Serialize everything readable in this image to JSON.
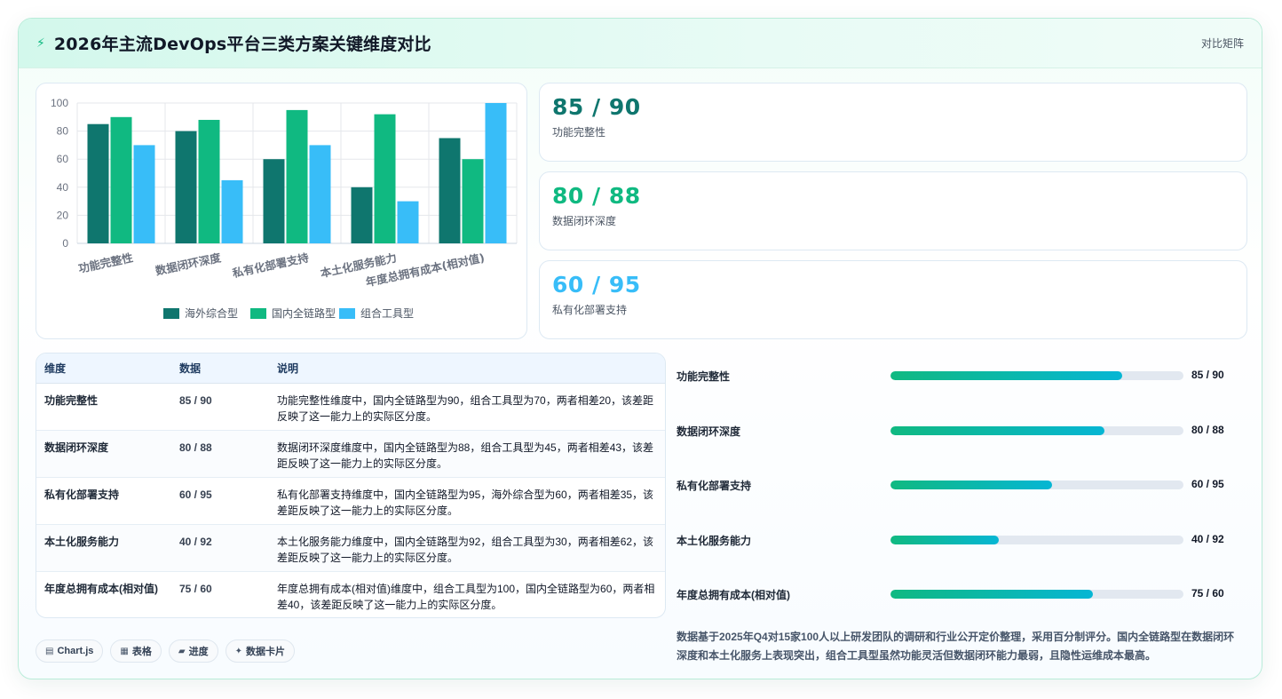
{
  "header": {
    "icon": "bolt-icon",
    "title": "2026年主流DevOps平台三类方案关键维度对比",
    "badge": "对比矩阵"
  },
  "colors": {
    "series_1": "#0f766e",
    "series_2": "#10b981",
    "series_3": "#38bdf8"
  },
  "chart_data": {
    "type": "bar",
    "categories": [
      "功能完整性",
      "数据闭环深度",
      "私有化部署支持",
      "本土化服务能力",
      "年度总拥有成本(相对值)"
    ],
    "series": [
      {
        "name": "海外综合型",
        "values": [
          85,
          80,
          60,
          40,
          75
        ]
      },
      {
        "name": "国内全链路型",
        "values": [
          90,
          88,
          95,
          92,
          60
        ]
      },
      {
        "name": "组合工具型",
        "values": [
          70,
          45,
          70,
          30,
          100
        ]
      }
    ],
    "ylim": [
      0,
      100
    ],
    "yticks": [
      0,
      20,
      40,
      60,
      80,
      100
    ],
    "grid": true,
    "legend_position": "bottom"
  },
  "stats": [
    {
      "value": "85 / 90",
      "label": "功能完整性",
      "color": "#0f766e"
    },
    {
      "value": "80 / 88",
      "label": "数据闭环深度",
      "color": "#10b981"
    },
    {
      "value": "60 / 95",
      "label": "私有化部署支持",
      "color": "#38bdf8"
    }
  ],
  "table": {
    "headers": [
      "维度",
      "数据",
      "说明"
    ],
    "rows": [
      {
        "dim": "功能完整性",
        "data": "85 / 90",
        "desc": "功能完整性维度中，国内全链路型为90，组合工具型为70，两者相差20，该差距反映了这一能力上的实际区分度。"
      },
      {
        "dim": "数据闭环深度",
        "data": "80 / 88",
        "desc": "数据闭环深度维度中，国内全链路型为88，组合工具型为45，两者相差43，该差距反映了这一能力上的实际区分度。"
      },
      {
        "dim": "私有化部署支持",
        "data": "60 / 95",
        "desc": "私有化部署支持维度中，国内全链路型为95，海外综合型为60，两者相差35，该差距反映了这一能力上的实际区分度。"
      },
      {
        "dim": "本土化服务能力",
        "data": "40 / 92",
        "desc": "本土化服务能力维度中，国内全链路型为92，组合工具型为30，两者相差62，该差距反映了这一能力上的实际区分度。"
      },
      {
        "dim": "年度总拥有成本(相对值)",
        "data": "75 / 60",
        "desc": "年度总拥有成本(相对值)维度中，组合工具型为100，国内全链路型为60，两者相差40，该差距反映了这一能力上的实际区分度。"
      }
    ]
  },
  "progress": [
    {
      "label": "功能完整性",
      "value": "85 / 90",
      "percent": 79
    },
    {
      "label": "数据闭环深度",
      "value": "80 / 88",
      "percent": 73
    },
    {
      "label": "私有化部署支持",
      "value": "60 / 95",
      "percent": 55
    },
    {
      "label": "本土化服务能力",
      "value": "40 / 92",
      "percent": 37
    },
    {
      "label": "年度总拥有成本(相对值)",
      "value": "75 / 60",
      "percent": 69
    }
  ],
  "tags": [
    {
      "icon": "chart-icon",
      "glyph": "▤",
      "label": "Chart.js"
    },
    {
      "icon": "table-icon",
      "glyph": "▦",
      "label": "表格"
    },
    {
      "icon": "progress-icon",
      "glyph": "▰",
      "label": "进度"
    },
    {
      "icon": "sparkle-icon",
      "glyph": "✦",
      "label": "数据卡片"
    }
  ],
  "note": "数据基于2025年Q4对15家100人以上研发团队的调研和行业公开定价整理，采用百分制评分。国内全链路型在数据闭环深度和本土化服务上表现突出，组合工具型虽然功能灵活但数据闭环能力最弱，且隐性运维成本最高。"
}
